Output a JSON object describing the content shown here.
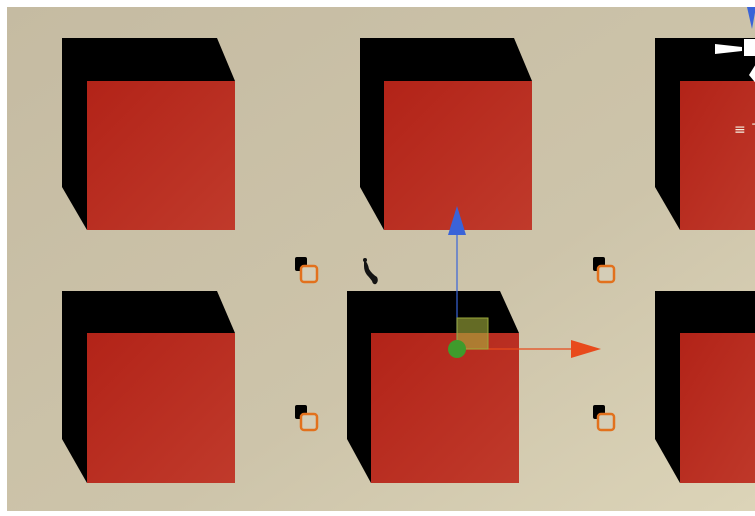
{
  "app": {
    "view": "scene-viewport"
  },
  "colors": {
    "background": "#c9bfa5",
    "cube_front": "#b52519",
    "cube_side": "#000000",
    "handle_outline": "#e2711d",
    "handle_fill": "#d4cdb7",
    "gizmo_x_axis": "#e84a1c",
    "gizmo_y_axis": "#3a63d8",
    "gizmo_center": "#3f9b2c",
    "gizmo_plane": "#a7b23e",
    "orientation_gizmo": "#ffffff"
  },
  "scene": {
    "cube_count": 6,
    "selected_cube_index": 4,
    "handle_count": 4,
    "gizmo": "move-tool"
  },
  "orientation_gizmo": {
    "label_glyph": "≡",
    "label_partial": "T",
    "icon": "axis-orientation-icon"
  }
}
